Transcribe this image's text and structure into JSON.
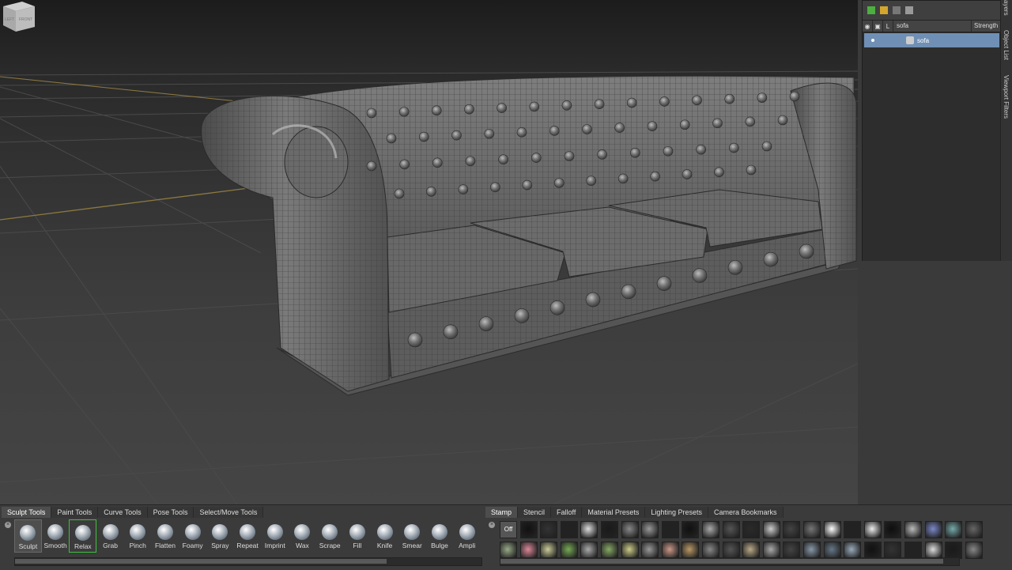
{
  "viewport": {
    "cube_labels": [
      "LEFT",
      "FRONT"
    ]
  },
  "right_panel": {
    "header": {
      "visibility": "◉",
      "lock": "▣",
      "l_label": "L",
      "name": "sofa",
      "strength": "Strength"
    },
    "layers": [
      {
        "name": "sofa",
        "selected": true
      }
    ],
    "side_tabs": [
      "ayers",
      "Object List",
      "Viewport Filters"
    ]
  },
  "bottom": {
    "left_tabs": [
      "Sculpt Tools",
      "Paint Tools",
      "Curve Tools",
      "Pose Tools",
      "Select/Move Tools"
    ],
    "active_left_tab": "Sculpt Tools",
    "close_glyph": "×",
    "tools": [
      {
        "label": "Sculpt",
        "selected": true
      },
      {
        "label": "Smooth"
      },
      {
        "label": "Relax",
        "outlined": true
      },
      {
        "label": "Grab"
      },
      {
        "label": "Pinch"
      },
      {
        "label": "Flatten"
      },
      {
        "label": "Foamy"
      },
      {
        "label": "Spray"
      },
      {
        "label": "Repeat"
      },
      {
        "label": "Imprint"
      },
      {
        "label": "Wax"
      },
      {
        "label": "Scrape"
      },
      {
        "label": "Fill"
      },
      {
        "label": "Knife"
      },
      {
        "label": "Smear"
      },
      {
        "label": "Bulge"
      },
      {
        "label": "Ampli"
      }
    ],
    "right_tabs": [
      "Stamp",
      "Stencil",
      "Falloff",
      "Material Presets",
      "Lighting Presets",
      "Camera Bookmarks"
    ],
    "active_right_tab": "Stamp",
    "stamp_off_label": "Off",
    "scroll_arrows": [
      "◀",
      "▶"
    ]
  }
}
